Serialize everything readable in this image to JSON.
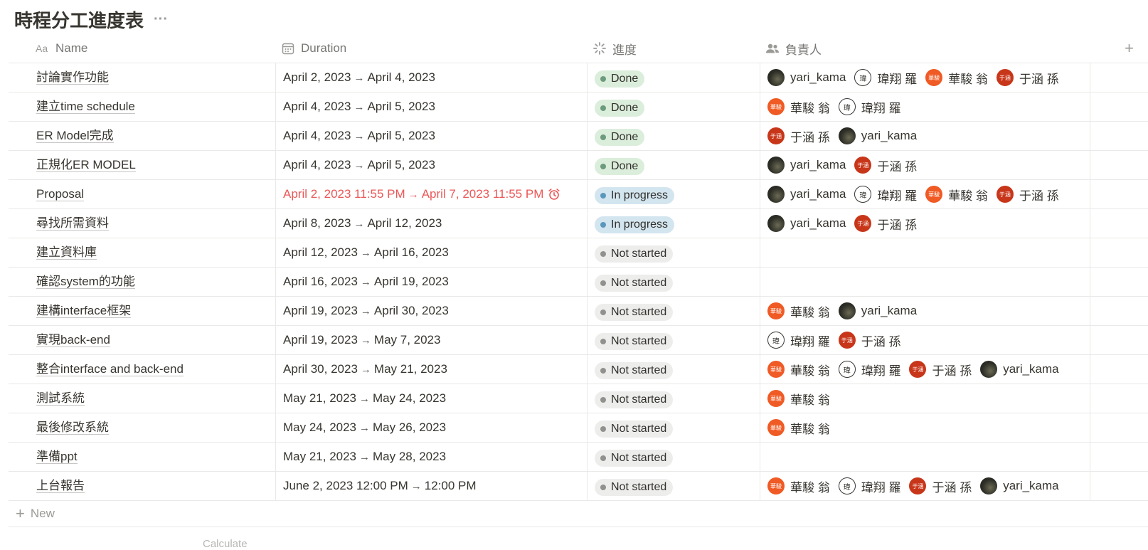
{
  "page": {
    "title": "時程分工進度表",
    "more": "···"
  },
  "columns": {
    "name": "Name",
    "duration": "Duration",
    "progress": "進度",
    "owners": "負責人",
    "add": "+"
  },
  "rows": [
    {
      "name": "討論實作功能",
      "start": "April 2, 2023",
      "end": "April 4, 2023",
      "status": "Done",
      "owners": [
        "yari_kama",
        "瑋翔 羅",
        "華駿 翁",
        "于涵 孫"
      ]
    },
    {
      "name": "建立time schedule",
      "start": "April 4, 2023",
      "end": "April 5, 2023",
      "status": "Done",
      "owners": [
        "華駿 翁",
        "瑋翔 羅"
      ]
    },
    {
      "name": "ER Model完成",
      "start": "April 4, 2023",
      "end": "April 5, 2023",
      "status": "Done",
      "owners": [
        "于涵 孫",
        "yari_kama"
      ]
    },
    {
      "name": "正規化ER MODEL",
      "start": "April 4, 2023",
      "end": "April 5, 2023",
      "status": "Done",
      "owners": [
        "yari_kama",
        "于涵 孫"
      ]
    },
    {
      "name": "Proposal",
      "start": "April 2, 2023 11:55 PM",
      "end": "April 7, 2023 11:55 PM",
      "overdue": true,
      "status": "In progress",
      "owners": [
        "yari_kama",
        "瑋翔 羅",
        "華駿 翁",
        "于涵 孫"
      ]
    },
    {
      "name": "尋找所需資料",
      "start": "April 8, 2023",
      "end": "April 12, 2023",
      "status": "In progress",
      "owners": [
        "yari_kama",
        "于涵 孫"
      ]
    },
    {
      "name": "建立資料庫",
      "start": "April 12, 2023",
      "end": "April 16, 2023",
      "status": "Not started",
      "owners": []
    },
    {
      "name": "確認system的功能",
      "start": "April 16, 2023",
      "end": "April 19, 2023",
      "status": "Not started",
      "owners": []
    },
    {
      "name": "建構interface框架",
      "start": "April 19, 2023",
      "end": "April 30, 2023",
      "status": "Not started",
      "owners": [
        "華駿 翁",
        "yari_kama"
      ]
    },
    {
      "name": "實現back-end",
      "start": "April 19, 2023",
      "end": "May 7, 2023",
      "status": "Not started",
      "owners": [
        "瑋翔 羅",
        "于涵 孫"
      ]
    },
    {
      "name": "整合interface and back-end",
      "start": "April 30, 2023",
      "end": "May 21, 2023",
      "status": "Not started",
      "owners": [
        "華駿 翁",
        "瑋翔 羅",
        "于涵 孫",
        "yari_kama"
      ]
    },
    {
      "name": "測試系統",
      "start": "May 21, 2023",
      "end": "May 24, 2023",
      "status": "Not started",
      "owners": [
        "華駿 翁"
      ]
    },
    {
      "name": "最後修改系統",
      "start": "May 24, 2023",
      "end": "May 26, 2023",
      "status": "Not started",
      "owners": [
        "華駿 翁"
      ]
    },
    {
      "name": "準備ppt",
      "start": "May 21, 2023",
      "end": "May 28, 2023",
      "status": "Not started",
      "owners": []
    },
    {
      "name": "上台報告",
      "start": "June 2, 2023 12:00 PM",
      "end": "12:00 PM",
      "status": "Not started",
      "owners": [
        "華駿 翁",
        "瑋翔 羅",
        "于涵 孫",
        "yari_kama"
      ]
    }
  ],
  "people": {
    "yari_kama": {
      "avatar": "photo",
      "initials": ""
    },
    "瑋翔 羅": {
      "avatar": "outline",
      "initials": "瑋"
    },
    "華駿 翁": {
      "avatar": "orange",
      "initials": "華駿"
    },
    "于涵 孫": {
      "avatar": "red",
      "initials": "于涵"
    }
  },
  "new_row_label": "New",
  "calculate_label": "Calculate",
  "colors": {
    "done": "#dbeddb",
    "in_progress": "#d3e5ef",
    "not_started": "#ededec",
    "overdue": "#eb5757"
  }
}
